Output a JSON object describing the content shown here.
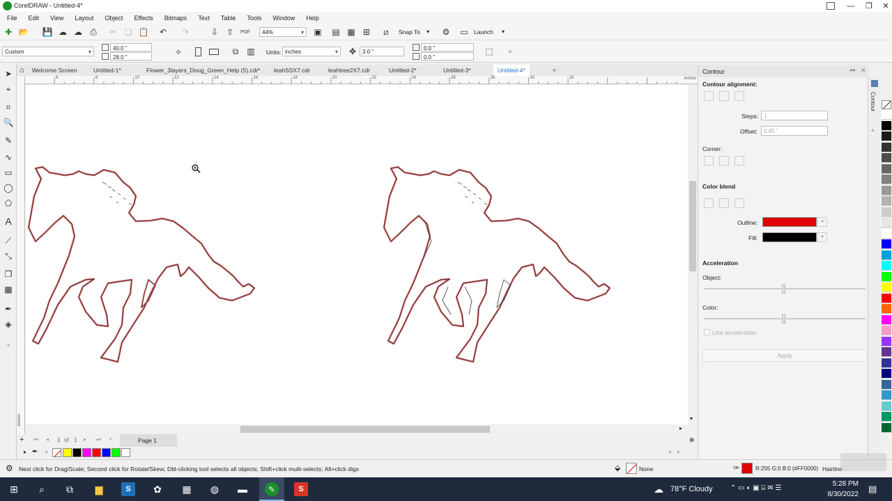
{
  "window": {
    "title": "CorelDRAW - Untitled-4*"
  },
  "menu": [
    "File",
    "Edit",
    "View",
    "Layout",
    "Object",
    "Effects",
    "Bitmaps",
    "Text",
    "Table",
    "Tools",
    "Window",
    "Help"
  ],
  "toolbar1": {
    "zoom": "44%",
    "snap": "Snap To",
    "launch": "Launch"
  },
  "toolbar2": {
    "page_preset": "Custom",
    "width": "40.0 \"",
    "height": "28.0 \"",
    "units_label": "Units:",
    "units_value": "inches",
    "nudge": "3.0 \"",
    "dup_x": "0.0 \"",
    "dup_y": "0.0 \""
  },
  "tabs": [
    "Welcome Screen",
    "Untitled-1*",
    "Flower_3layers_Doug_Green_Help (5).cdr*",
    "leahSSX7.cdr",
    "leahtree2X7.cdr",
    "Untitled-2*",
    "Untitled-3*",
    "Untitled-4*"
  ],
  "ruler": {
    "unit": "inches",
    "ticks": [
      "6",
      "8",
      "10",
      "12",
      "14",
      "16",
      "18",
      "20",
      "22",
      "24",
      "26",
      "28",
      "30",
      "32"
    ],
    "v_unit": "inches"
  },
  "pagebar": {
    "current": "1",
    "of": "of",
    "total": "1",
    "page_tab": "Page 1"
  },
  "docker": {
    "title": "Contour",
    "alignment_label": "Contour alignment:",
    "steps_label": "Steps:",
    "steps_value": "1",
    "offset_label": "Offset:",
    "offset_value": "0.45 \"",
    "corner_label": "Corner:",
    "color_blend_label": "Color blend",
    "outline_label": "Outline:",
    "fill_label": "Fill:",
    "outline_color": "#e00000",
    "fill_color": "#000000",
    "acceleration_label": "Acceleration",
    "object_label": "Object:",
    "color_label": "Color:",
    "link_label": "Link acceleration",
    "apply_label": "Apply",
    "side_tab": "Contour"
  },
  "statusbar": {
    "hint": "Next click for Drag/Scale; Second click for Rotate/Skew; Dbl-clicking tool selects all objects; Shift+click multi-selects; Alt+click digs",
    "fill_none": "None",
    "outline_info": "R:255 G:0 B:0 (#FF0000)",
    "outline_width": "Hairline"
  },
  "taskbar": {
    "weather": "78°F Cloudy",
    "time": "5:28 PM",
    "date": "8/30/2022"
  },
  "palette_colors": [
    "#ffffff",
    "#000000",
    "#1a1a1a",
    "#333333",
    "#4d4d4d",
    "#666666",
    "#808080",
    "#999999",
    "#b3b3b3",
    "#cccccc",
    "#e6e6e6",
    "#ffffff",
    "#0000ff",
    "#00a0e0",
    "#00ffff",
    "#00ff00",
    "#ffff00",
    "#ff0000",
    "#ff6600",
    "#ff00ff",
    "#ff99cc",
    "#9933ff",
    "#663399",
    "#333399",
    "#000080",
    "#336699",
    "#3399cc",
    "#66cccc",
    "#009966",
    "#006633"
  ],
  "bottom_swatches": [
    "#ffff00",
    "#000000",
    "#ff00ff",
    "#ff0000",
    "#0000ff",
    "#00ff00",
    "#ffffff"
  ]
}
